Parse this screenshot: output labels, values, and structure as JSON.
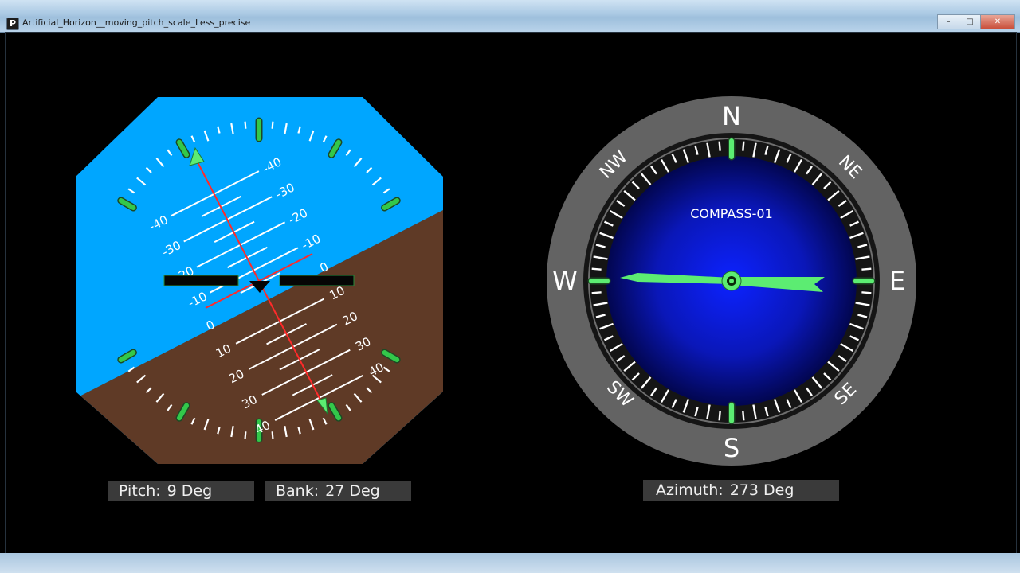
{
  "window": {
    "title": "Artificial_Horizon__moving_pitch_scale_Less_precise",
    "icon_letter": "P",
    "controls": {
      "minimize": "–",
      "maximize": "□",
      "close": "✕"
    }
  },
  "horizon": {
    "pitch_scale_upper": [
      "-40",
      "-30",
      "-20",
      "-10",
      "0"
    ],
    "pitch_scale_lower": [
      "10",
      "20",
      "30",
      "40"
    ],
    "colors": {
      "sky": "#00a6ff",
      "ground": "#5f3a26",
      "marker": "#33c84a",
      "pointer": "#ff2a2a"
    }
  },
  "compass": {
    "title": "COMPASS-01",
    "cardinals": {
      "n": "N",
      "e": "E",
      "s": "S",
      "w": "W"
    },
    "intercardinals": {
      "ne": "NE",
      "se": "SE",
      "sw": "SW",
      "nw": "NW"
    },
    "colors": {
      "bezel": "#636363",
      "face": "#0a1cd6",
      "needle": "#5cec72"
    }
  },
  "readouts": {
    "pitch": {
      "label": "Pitch:",
      "value": "9 Deg"
    },
    "bank": {
      "label": "Bank:",
      "value": "27 Deg"
    },
    "azimuth": {
      "label": "Azimuth:",
      "value": "273 Deg"
    }
  }
}
